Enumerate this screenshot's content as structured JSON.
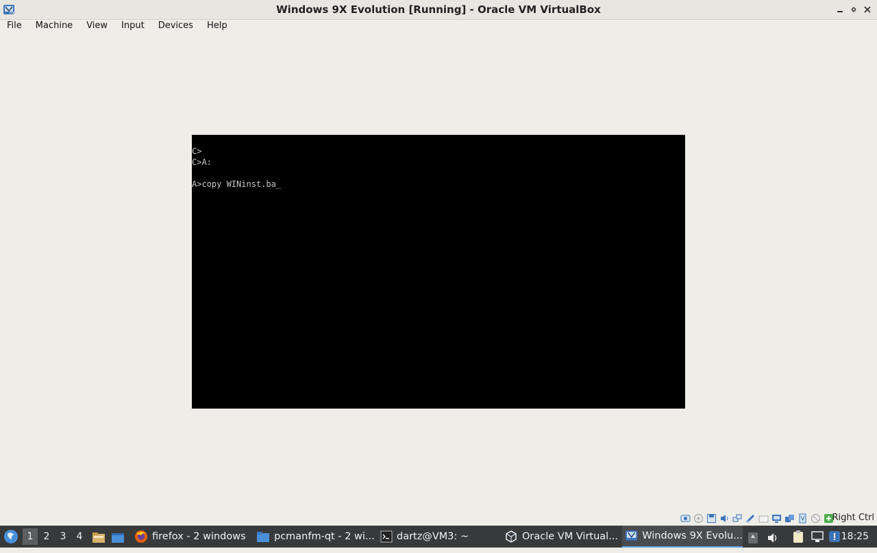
{
  "window": {
    "title": "Windows 9X Evolution [Running] - Oracle VM VirtualBox"
  },
  "menubar": {
    "items": [
      "File",
      "Machine",
      "View",
      "Input",
      "Devices",
      "Help"
    ]
  },
  "vm_console": {
    "lines": [
      "C>",
      "C>A:",
      "",
      "A>copy WINinst.ba_"
    ]
  },
  "status_bar": {
    "icons": [
      "hard-disk-icon",
      "optical-drive-icon",
      "floppy-drive-icon",
      "audio-icon",
      "network-icon",
      "usb-icon",
      "shared-folders-icon",
      "display-icon",
      "video-capture-icon",
      "cpu-icon",
      "mouse-integration-icon",
      "keyboard-capture-icon"
    ],
    "host_key": "Right Ctrl"
  },
  "taskbar": {
    "desktops": [
      "1",
      "2",
      "3",
      "4"
    ],
    "active_desktop": "1",
    "tasks": [
      {
        "label": "firefox - 2 windows",
        "icon": "firefox-icon"
      },
      {
        "label": "pcmanfm-qt - 2 wi...",
        "icon": "folder-icon"
      },
      {
        "label": "dartz@VM3: ~",
        "icon": "terminal-icon"
      },
      {
        "label": "Oracle VM Virtual...",
        "icon": "virtualbox-icon"
      },
      {
        "label": "Windows 9X Evolu...",
        "icon": "virtualbox-vm-icon"
      }
    ],
    "clock": "18:25"
  },
  "colors": {
    "desktop_bg": "#efede8",
    "taskbar_bg": "#38393b",
    "vm_screen_bg": "#000000",
    "console_text": "#c8c8c8",
    "active_task_accent": "#5d9bd8"
  }
}
